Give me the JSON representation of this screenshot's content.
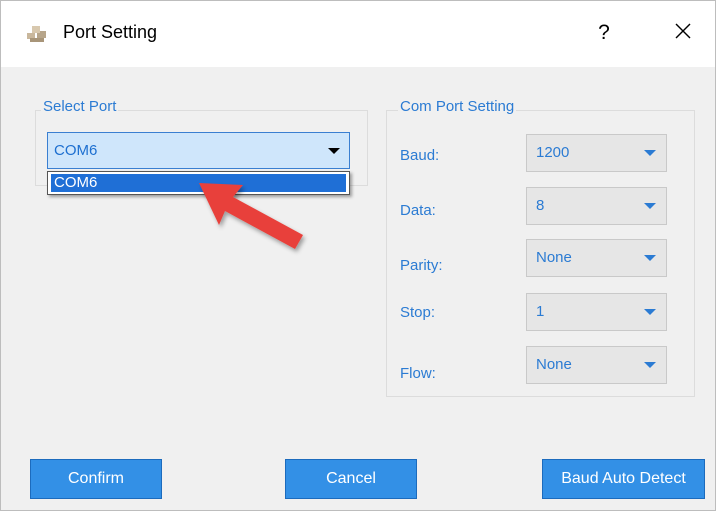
{
  "window": {
    "title": "Port Setting",
    "help_label": "?",
    "icon": "app-icon",
    "close_icon": "close-icon"
  },
  "select_port": {
    "legend": "Select Port",
    "selected": "COM6",
    "options": [
      "COM6"
    ]
  },
  "com_port_setting": {
    "legend": "Com Port Setting",
    "fields": [
      {
        "label": "Baud:",
        "value": "1200"
      },
      {
        "label": "Data:",
        "value": "8"
      },
      {
        "label": "Parity:",
        "value": "None"
      },
      {
        "label": "Stop:",
        "value": "1"
      },
      {
        "label": "Flow:",
        "value": "None"
      }
    ]
  },
  "buttons": {
    "confirm": "Confirm",
    "cancel": "Cancel",
    "auto_detect": "Baud Auto Detect"
  },
  "colors": {
    "accent": "#3390e6",
    "label_text": "#2b7bd3",
    "selection": "#1f6fd6",
    "annotation_arrow": "#e8403a"
  }
}
